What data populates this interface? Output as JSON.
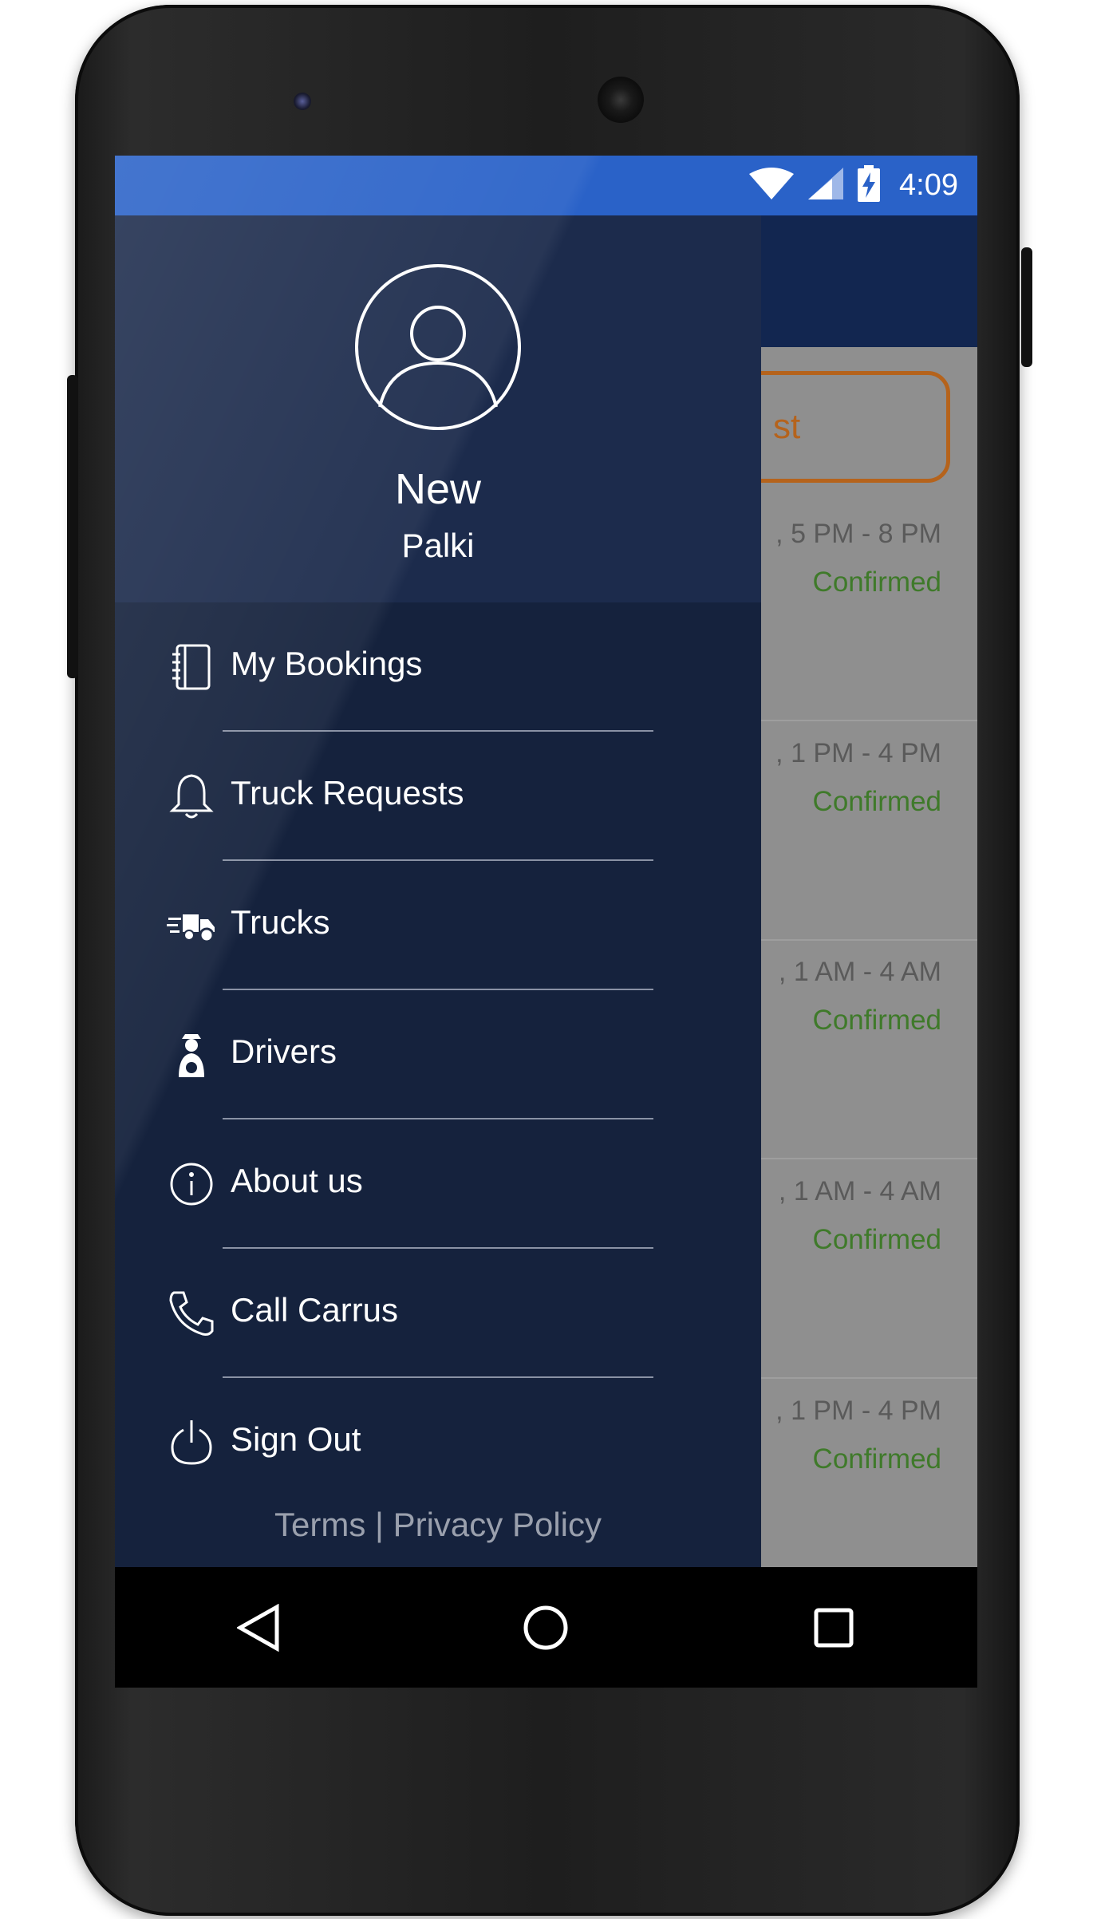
{
  "status_bar": {
    "time": "4:09",
    "icons": [
      "wifi-icon",
      "signal-icon",
      "battery-charging-icon"
    ]
  },
  "background_list": {
    "button_fragment": "st",
    "rows": [
      {
        "time": ", 5 PM - 8 PM",
        "status": "Confirmed"
      },
      {
        "time": ", 1 PM - 4 PM",
        "status": "Confirmed"
      },
      {
        "time": ", 1 AM - 4 AM",
        "status": "Confirmed"
      },
      {
        "time": ", 1 AM - 4 AM",
        "status": "Confirmed"
      },
      {
        "time": ", 1 PM - 4 PM",
        "status": "Confirmed"
      }
    ],
    "status_color": "#3f7a2a"
  },
  "drawer": {
    "user": {
      "name": "New",
      "subtitle": "Palki",
      "avatar_icon": "user-avatar-icon"
    },
    "menu": [
      {
        "label": "My Bookings",
        "icon": "notebook-icon"
      },
      {
        "label": "Truck Requests",
        "icon": "bell-icon"
      },
      {
        "label": "Trucks",
        "icon": "truck-icon"
      },
      {
        "label": "Drivers",
        "icon": "driver-icon"
      },
      {
        "label": "About us",
        "icon": "info-icon"
      },
      {
        "label": "Call Carrus",
        "icon": "phone-icon"
      },
      {
        "label": "Sign Out",
        "icon": "power-icon"
      }
    ],
    "footer": {
      "terms": "Terms",
      "separator": "|",
      "privacy": "Privacy Policy"
    }
  },
  "nav_bar": {
    "buttons": [
      "back-icon",
      "home-icon",
      "recents-icon"
    ]
  },
  "colors": {
    "status_bar": "#2a62c8",
    "drawer": "#15223d",
    "drawer_header": "#1c2b4c",
    "accent_orange": "#b5631c"
  }
}
